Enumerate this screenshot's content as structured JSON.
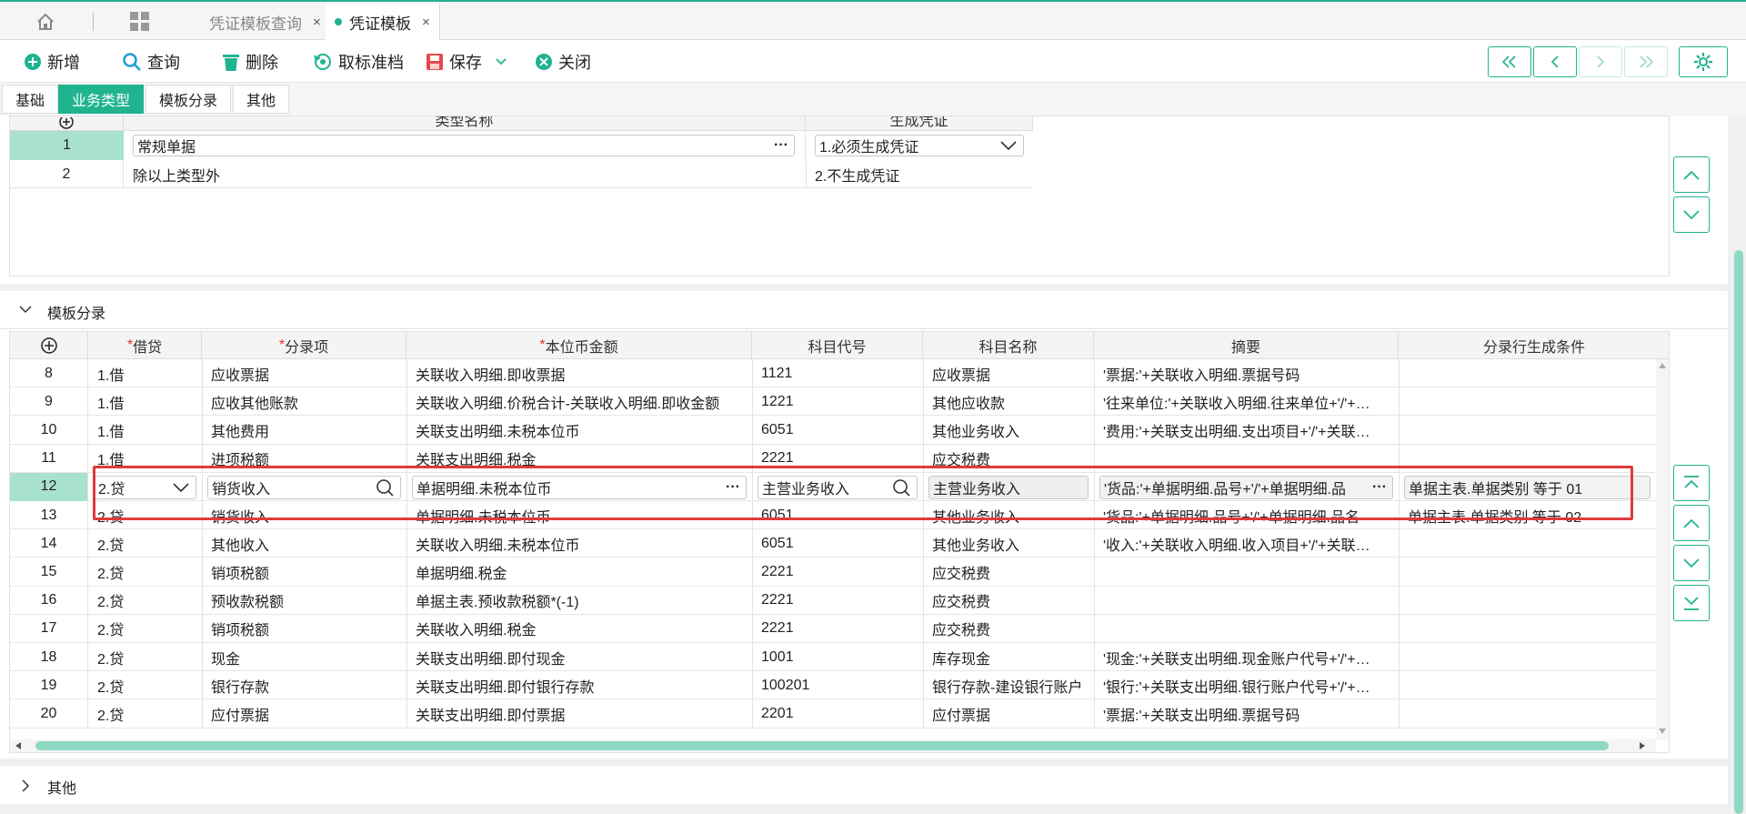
{
  "tabs": {
    "query_tab": "凭证模板查询",
    "template_tab": "凭证模板",
    "close_glyph": "×"
  },
  "toolbar": {
    "new": "新增",
    "query": "查询",
    "delete": "删除",
    "cancel_std": "取标准档",
    "save": "保存",
    "close": "关闭"
  },
  "section_tabs": [
    "基础",
    "业务类型",
    "模板分录",
    "其他"
  ],
  "biz_types": {
    "headers": {
      "name": "类型名称",
      "voucher": "生成凭证"
    },
    "rows": [
      {
        "no": "1",
        "name": "常规单据",
        "voucher": "1.必须生成凭证"
      },
      {
        "no": "2",
        "name": "除以上类型外",
        "voucher": "2.不生成凭证"
      }
    ]
  },
  "entries": {
    "section_title": "模板分录",
    "headers": {
      "dc": "借贷",
      "item": "分录项",
      "amount": "本位币金额",
      "code": "科目代号",
      "acct": "科目名称",
      "summary": "摘要",
      "cond": "分录行生成条件"
    },
    "required_mark": "*",
    "rows": [
      {
        "no": "8",
        "dc": "1.借",
        "item": "应收票据",
        "amount": "关联收入明细.即收票据",
        "code": "1121",
        "acct": "应收票据",
        "summary": "'票据:'+关联收入明细.票据号码",
        "cond": ""
      },
      {
        "no": "9",
        "dc": "1.借",
        "item": "应收其他账款",
        "amount": "关联收入明细.价税合计-关联收入明细.即收金额",
        "code": "1221",
        "acct": "其他应收款",
        "summary": "'往来单位:'+关联收入明细.往来单位+'/'+…",
        "cond": ""
      },
      {
        "no": "10",
        "dc": "1.借",
        "item": "其他费用",
        "amount": "关联支出明细.未税本位币",
        "code": "6051",
        "acct": "其他业务收入",
        "summary": "'费用:'+关联支出明细.支出项目+'/'+关联…",
        "cond": ""
      },
      {
        "no": "11",
        "dc": "1.借",
        "item": "进项税额",
        "amount": "关联支出明细.税金",
        "code": "2221",
        "acct": "应交税费",
        "summary": "",
        "cond": ""
      },
      {
        "no": "12",
        "dc": "2.贷",
        "item": "销货收入",
        "amount": "单据明细.未税本位币",
        "code": "主营业务收入",
        "acct": "主营业务收入",
        "summary": "'货品:'+单据明细.品号+'/'+单据明细.品",
        "cond": "单据主表.单据类别 等于  01"
      },
      {
        "no": "13",
        "dc": "2.贷",
        "item": "销货收入",
        "amount": "单据明细.未税本位币",
        "code": "6051",
        "acct": "其他业务收入",
        "summary": "'货品:'+单据明细.品号+'/'+单据明细.品名",
        "cond": "单据主表.单据类别 等于 02"
      },
      {
        "no": "14",
        "dc": "2.贷",
        "item": "其他收入",
        "amount": "关联收入明细.未税本位币",
        "code": "6051",
        "acct": "其他业务收入",
        "summary": "'收入:'+关联收入明细.收入项目+'/'+关联…",
        "cond": ""
      },
      {
        "no": "15",
        "dc": "2.贷",
        "item": "销项税额",
        "amount": "单据明细.税金",
        "code": "2221",
        "acct": "应交税费",
        "summary": "",
        "cond": ""
      },
      {
        "no": "16",
        "dc": "2.贷",
        "item": "预收款税额",
        "amount": "单据主表.预收款税额*(-1)",
        "code": "2221",
        "acct": "应交税费",
        "summary": "",
        "cond": ""
      },
      {
        "no": "17",
        "dc": "2.贷",
        "item": "销项税额",
        "amount": "关联收入明细.税金",
        "code": "2221",
        "acct": "应交税费",
        "summary": "",
        "cond": ""
      },
      {
        "no": "18",
        "dc": "2.贷",
        "item": "现金",
        "amount": "关联支出明细.即付现金",
        "code": "1001",
        "acct": "库存现金",
        "summary": "'现金:'+关联支出明细.现金账户代号+'/'+…",
        "cond": ""
      },
      {
        "no": "19",
        "dc": "2.贷",
        "item": "银行存款",
        "amount": "关联支出明细.即付银行存款",
        "code": "100201",
        "acct": "银行存款-建设银行账户",
        "summary": "'银行:'+关联支出明细.银行账户代号+'/'+…",
        "cond": ""
      },
      {
        "no": "20",
        "dc": "2.贷",
        "item": "应付票据",
        "amount": "关联支出明细.即付票据",
        "code": "2201",
        "acct": "应付票据",
        "summary": "'票据:'+关联支出明细.票据号码",
        "cond": ""
      }
    ]
  },
  "other_section": "其他",
  "colors": {
    "accent": "#1fb38f",
    "selected_row": "#a8e2cf",
    "highlight_border": "#e03a3a"
  }
}
